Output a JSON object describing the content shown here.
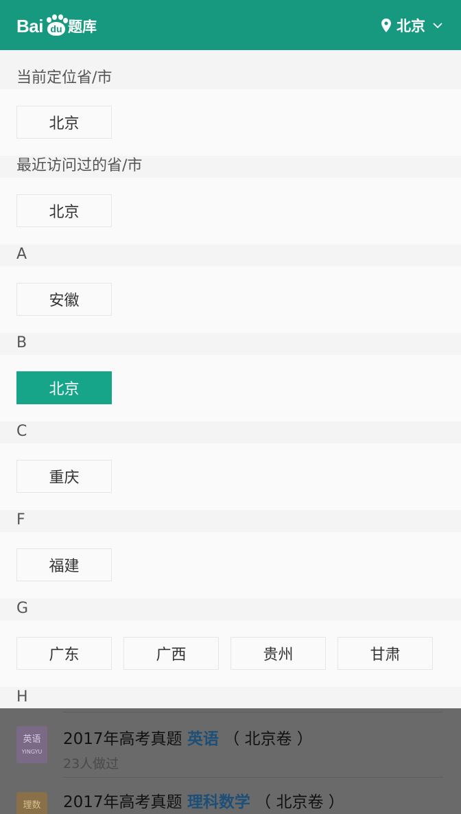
{
  "header": {
    "logo_bai": "Bai",
    "logo_du": "du",
    "logo_tiku": "题库",
    "location": "北京",
    "colors": {
      "brand": "#16997f",
      "active": "#16a589"
    }
  },
  "sections": {
    "current": {
      "title": "当前定位省/市",
      "items": [
        "北京"
      ]
    },
    "recent": {
      "title": "最近访问过的省/市",
      "items": [
        "北京"
      ]
    },
    "a": {
      "title": "A",
      "items": [
        "安徽"
      ]
    },
    "b": {
      "title": "B",
      "items": [
        "北京"
      ]
    },
    "c": {
      "title": "C",
      "items": [
        "重庆"
      ]
    },
    "f": {
      "title": "F",
      "items": [
        "福建"
      ]
    },
    "g": {
      "title": "G",
      "items": [
        "广东",
        "广西",
        "贵州",
        "甘肃"
      ]
    },
    "h": {
      "title": "H"
    }
  },
  "background_list": {
    "items": [
      {
        "icon_text": "英语",
        "icon_sub": "YINGYU",
        "title_prefix": "2017年高考真题 ",
        "subject": "英语",
        "title_suffix": " （ 北京卷 ）",
        "meta": "23人做过"
      },
      {
        "icon_text": "理数",
        "title_prefix": "2017年高考真题 ",
        "subject": "理科数学",
        "title_suffix": " （ 北京卷 ）"
      }
    ]
  }
}
